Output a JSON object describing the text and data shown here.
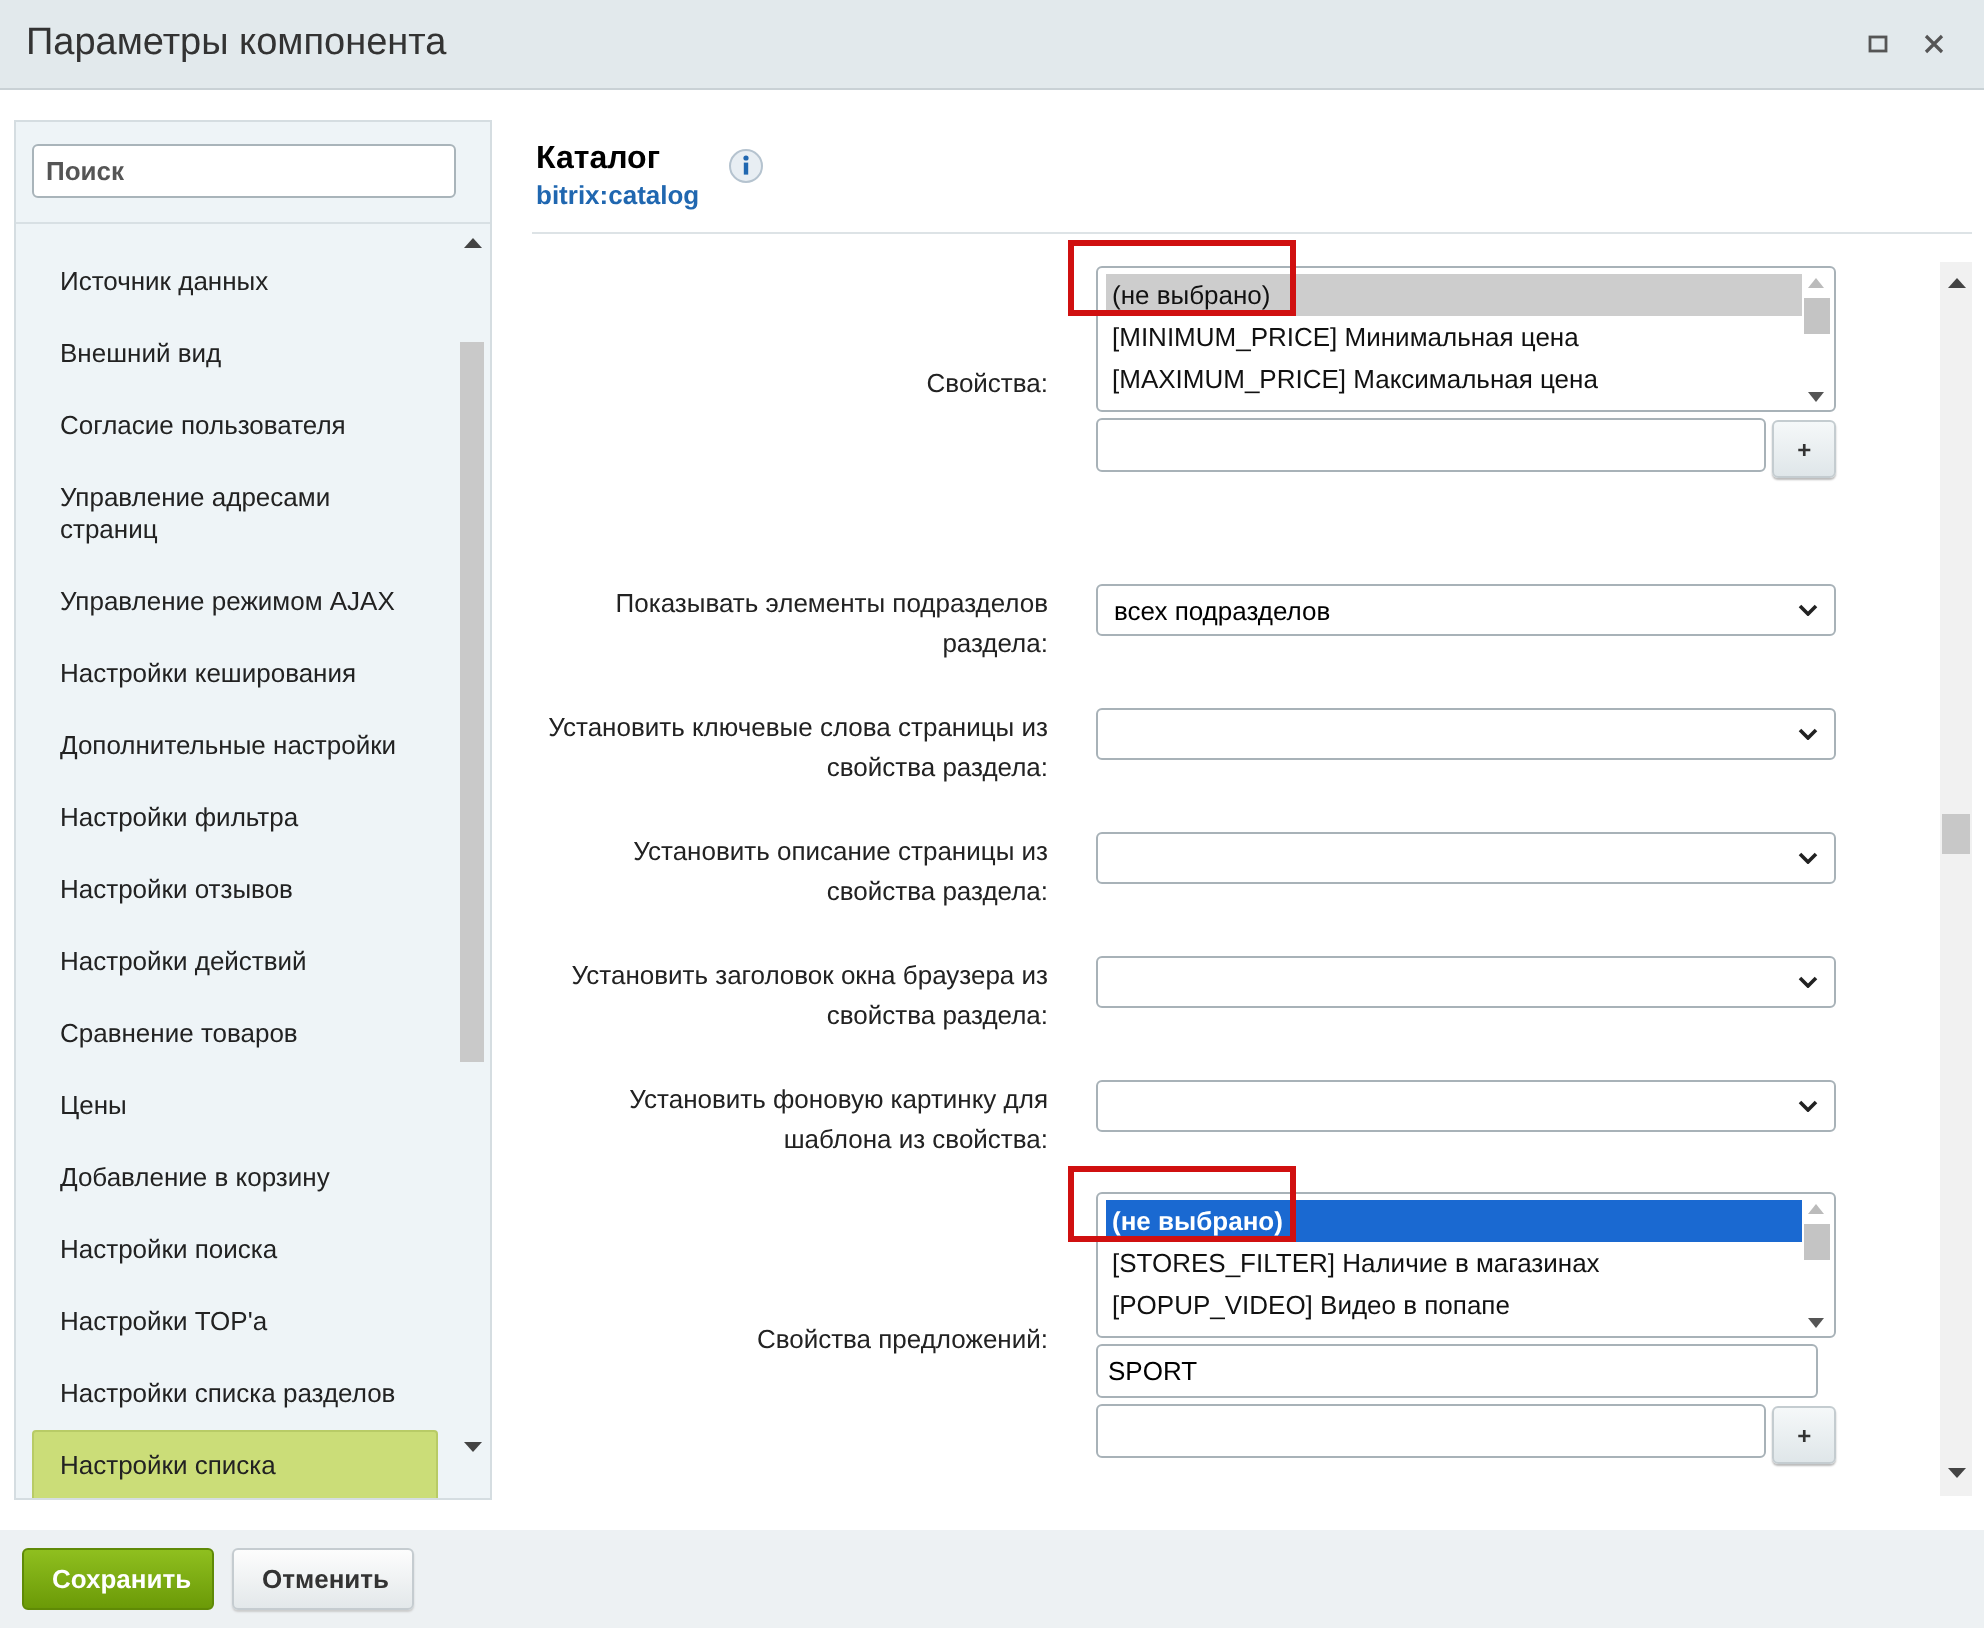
{
  "window": {
    "title": "Параметры компонента"
  },
  "sidebar": {
    "search": {
      "placeholder": "Поиск"
    },
    "items": [
      {
        "label": "Источник данных",
        "selected": false
      },
      {
        "label": "Внешний вид",
        "selected": false
      },
      {
        "label": "Согласие пользователя",
        "selected": false
      },
      {
        "label": "Управление адресами страниц",
        "selected": false
      },
      {
        "label": "Управление режимом AJAX",
        "selected": false
      },
      {
        "label": "Настройки кеширования",
        "selected": false
      },
      {
        "label": "Дополнительные настройки",
        "selected": false
      },
      {
        "label": "Настройки фильтра",
        "selected": false
      },
      {
        "label": "Настройки отзывов",
        "selected": false
      },
      {
        "label": "Настройки действий",
        "selected": false
      },
      {
        "label": "Сравнение товаров",
        "selected": false
      },
      {
        "label": "Цены",
        "selected": false
      },
      {
        "label": "Добавление в корзину",
        "selected": false
      },
      {
        "label": "Настройки поиска",
        "selected": false
      },
      {
        "label": "Настройки TOP'а",
        "selected": false
      },
      {
        "label": "Настройки списка разделов",
        "selected": false
      },
      {
        "label": "Настройки списка",
        "selected": true
      }
    ]
  },
  "component": {
    "title": "Каталог",
    "code": "bitrix:catalog"
  },
  "fields": [
    {
      "kind": "multiselect",
      "label": "Свойства:",
      "focused": false,
      "annotated": true,
      "options": [
        {
          "label": "(не выбрано)",
          "selected": true
        },
        {
          "label": "[MINIMUM_PRICE] Минимальная цена",
          "selected": false
        },
        {
          "label": "[MAXIMUM_PRICE] Максимальная цена",
          "selected": false
        }
      ],
      "add": "+"
    },
    {
      "kind": "select",
      "label": "Показывать элементы подразделов раздела:",
      "value": "всех подразделов"
    },
    {
      "kind": "select",
      "label": "Установить ключевые слова страницы из свойства раздела:"
    },
    {
      "kind": "select",
      "label": "Установить описание страницы из свойства раздела:"
    },
    {
      "kind": "select",
      "label": "Установить заголовок окна браузера из свойства раздела:"
    },
    {
      "kind": "select",
      "label": "Установить фоновую картинку для шаблона из свойства:"
    },
    {
      "kind": "multiselect",
      "label": "Свойства предложений:",
      "focused": true,
      "annotated": true,
      "options": [
        {
          "label": "(не выбрано)",
          "selected": true
        },
        {
          "label": "[STORES_FILTER] Наличие в магазинах",
          "selected": false
        },
        {
          "label": "[POPUP_VIDEO] Видео в попапе",
          "selected": false
        }
      ],
      "values": [
        "SPORT"
      ],
      "add": "+"
    }
  ],
  "buttons": [
    {
      "label": "Сохранить",
      "kind": "primary"
    },
    {
      "label": "Отменить",
      "kind": "secondary"
    }
  ]
}
